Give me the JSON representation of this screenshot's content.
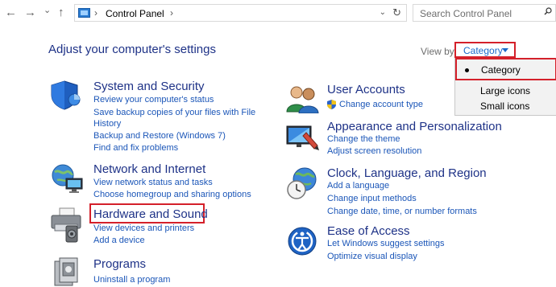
{
  "address_bar": {
    "back_glyph": "←",
    "forward_glyph": "→",
    "history_glyph": "⌄",
    "up_glyph": "↑",
    "chevron": "›",
    "path": "Control Panel",
    "dropdown_glyph": "⌄",
    "refresh_glyph": "↻"
  },
  "search": {
    "placeholder": "Search Control Panel"
  },
  "heading": "Adjust your computer's settings",
  "view_by": {
    "label": "View by:",
    "value": "Category",
    "options": [
      "Category",
      "Large icons",
      "Small icons"
    ]
  },
  "categories": {
    "system_security": {
      "title": "System and Security",
      "links": [
        "Review your computer's status",
        "Save backup copies of your files with File",
        "History",
        "Backup and Restore (Windows 7)",
        "Find and fix problems"
      ]
    },
    "network_internet": {
      "title": "Network and Internet",
      "links": [
        "View network status and tasks",
        "Choose homegroup and sharing options"
      ]
    },
    "hardware_sound": {
      "title": "Hardware and Sound",
      "links": [
        "View devices and printers",
        "Add a device"
      ]
    },
    "programs": {
      "title": "Programs",
      "links": [
        "Uninstall a program"
      ]
    },
    "user_accounts": {
      "title": "User Accounts",
      "links": [
        "Change account type"
      ]
    },
    "appearance": {
      "title": "Appearance and Personalization",
      "links": [
        "Change the theme",
        "Adjust screen resolution"
      ]
    },
    "clock_region": {
      "title": "Clock, Language, and Region",
      "links": [
        "Add a language",
        "Change input methods",
        "Change date, time, or number formats"
      ]
    },
    "ease_access": {
      "title": "Ease of Access",
      "links": [
        "Let Windows suggest settings",
        "Optimize visual display"
      ]
    }
  },
  "colors": {
    "heading_blue": "#1e3287",
    "link_blue": "#1b56b8",
    "highlight_red": "#d4202a"
  },
  "icons": [
    "shield-icon",
    "users-icon",
    "network-globe-icon",
    "appearance-icon",
    "printer-icon",
    "clock-globe-icon",
    "programs-icon",
    "ease-of-access-icon"
  ]
}
